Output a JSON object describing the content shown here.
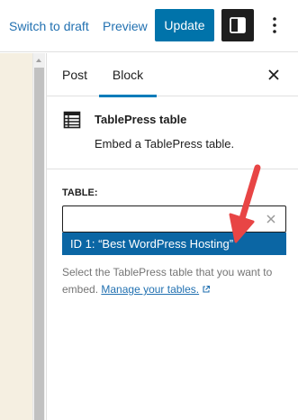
{
  "toolbar": {
    "switch_to_draft": "Switch to draft",
    "preview": "Preview",
    "update": "Update"
  },
  "sidebar": {
    "tabs": [
      {
        "label": "Post",
        "active": false
      },
      {
        "label": "Block",
        "active": true
      }
    ],
    "block": {
      "icon": "table-icon",
      "title": "TablePress table",
      "description": "Embed a TablePress table."
    },
    "table_field": {
      "label": "TABLE:",
      "value": "",
      "suggestion": "ID 1: “Best WordPress Hosting”"
    },
    "help": {
      "text": "Select the TablePress table that you want to embed.",
      "link": "Manage your tables."
    }
  },
  "colors": {
    "accent": "#0073aa",
    "highlight": "#0b66a4",
    "annotation_arrow": "#e84545",
    "canvas": "#f5efe1"
  }
}
